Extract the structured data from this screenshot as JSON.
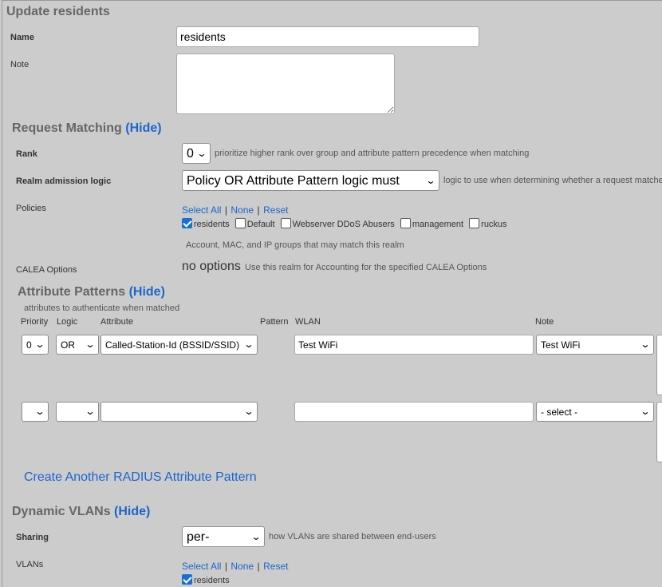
{
  "page": {
    "title": "Update residents"
  },
  "form": {
    "name_label": "Name",
    "name_value": "residents",
    "note_label": "Note"
  },
  "request_matching": {
    "title": "Request Matching",
    "hide_label": "(Hide)",
    "rank": {
      "label": "Rank",
      "value": "0",
      "hint": "prioritize higher rank over group and attribute pattern precedence when matching"
    },
    "realm_logic": {
      "label": "Realm admission logic",
      "value": "Policy OR Attribute Pattern logic must succeed",
      "hint": "logic to use when determining whether a request matches"
    },
    "policies": {
      "label": "Policies",
      "select_all": "Select All",
      "none": "None",
      "reset": "Reset",
      "separator": "|",
      "items": [
        {
          "label": "residents",
          "checked": true
        },
        {
          "label": "Default",
          "checked": false
        },
        {
          "label": "Webserver DDoS Abusers",
          "checked": false
        },
        {
          "label": "management",
          "checked": false
        },
        {
          "label": "ruckus",
          "checked": false
        }
      ],
      "hint": "Account, MAC, and IP groups that may match this realm"
    },
    "calea": {
      "label": "CALEA Options",
      "value": "no options",
      "hint": "Use this realm for Accounting for the specified CALEA Options"
    }
  },
  "attribute_patterns": {
    "title": "Attribute Patterns",
    "hide_label": "(Hide)",
    "subtitle": "attributes to authenticate when matched",
    "columns": {
      "priority": "Priority",
      "logic": "Logic",
      "attribute": "Attribute",
      "pattern": "Pattern",
      "wlan": "WLAN",
      "note": "Note"
    },
    "rows": [
      {
        "priority": "0",
        "logic": "OR",
        "attribute": "Called-Station-Id (BSSID/SSID)",
        "pattern": "Test WiFi",
        "wlan": "Test WiFi"
      },
      {
        "priority": "",
        "logic": "",
        "attribute": "",
        "pattern": "",
        "wlan": "- select -"
      }
    ],
    "create_link": "Create Another RADIUS Attribute Pattern"
  },
  "dynamic_vlans": {
    "title": "Dynamic VLANs",
    "hide_label": "(Hide)",
    "sharing": {
      "label": "Sharing",
      "value": "per-Account",
      "hint": "how VLANs are shared between end-users"
    },
    "vlans": {
      "label": "VLANs",
      "select_all": "Select All",
      "none": "None",
      "reset": "Reset",
      "separator": "|",
      "items": [
        {
          "label": "residents",
          "checked": true
        }
      ]
    }
  },
  "icons": {
    "dropdown": "chevron-down-icon",
    "checkbox_checked": "checkbox-checked-icon",
    "checkbox_unchecked": "checkbox-unchecked-icon"
  }
}
